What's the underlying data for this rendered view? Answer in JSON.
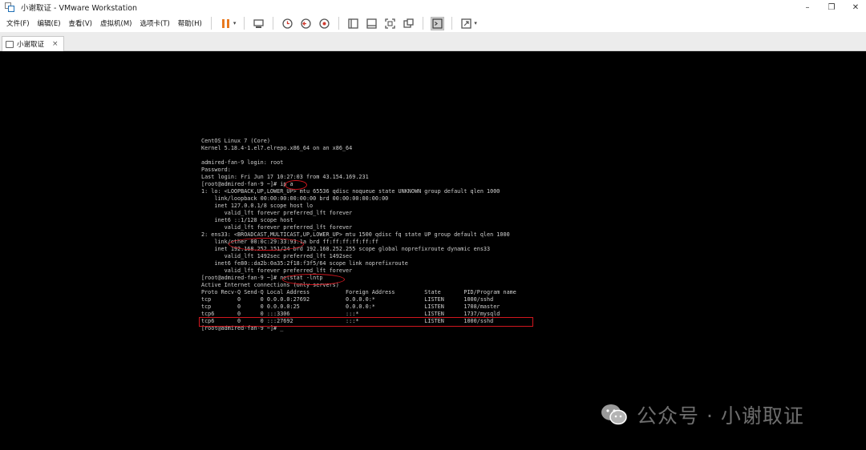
{
  "window": {
    "title": "小谢取证 - VMware Workstation",
    "controls": [
      "–",
      "❐",
      "✕"
    ]
  },
  "menu": {
    "items": [
      "文件(F)",
      "编辑(E)",
      "查看(V)",
      "虚拟机(M)",
      "选项卡(T)",
      "帮助(H)"
    ]
  },
  "toolbar": {
    "icons": [
      "pause-icon",
      "send-ctrl-alt-del-icon",
      "snapshot-icon",
      "revert-snapshot-icon",
      "snapshot-manager-icon",
      "view-normal-icon",
      "view-thumbnail-icon",
      "full-screen-icon",
      "unity-icon",
      "console-view-icon",
      "stretch-view-icon"
    ]
  },
  "tab": {
    "label": "小谢取证",
    "close": "×"
  },
  "terminal": {
    "lines": [
      "CentOS Linux 7 (Core)",
      "Kernel 5.18.4-1.el7.elrepo.x86_64 on an x86_64",
      "",
      "admired-fan-9 login: root",
      "Password:",
      "Last login: Fri Jun 17 10:27:03 from 43.154.169.231",
      "[root@admired-fan-9 ~]# ip a",
      "1: lo: <LOOPBACK,UP,LOWER_UP> mtu 65536 qdisc noqueue state UNKNOWN group default qlen 1000",
      "    link/loopback 00:00:00:00:00:00 brd 00:00:00:00:00:00",
      "    inet 127.0.0.1/8 scope host lo",
      "       valid_lft forever preferred_lft forever",
      "    inet6 ::1/128 scope host",
      "       valid_lft forever preferred_lft forever",
      "2: ens33: <BROADCAST,MULTICAST,UP,LOWER_UP> mtu 1500 qdisc fq state UP group default qlen 1000",
      "    link/ether 00:0c:29:33:93:1a brd ff:ff:ff:ff:ff:ff",
      "    inet 192.168.252.151/24 brd 192.168.252.255 scope global noprefixroute dynamic ens33",
      "       valid_lft 1492sec preferred_lft 1492sec",
      "    inet6 fe80::da2b:0a35:2f18:f3f5/64 scope link noprefixroute",
      "       valid_lft forever preferred_lft forever",
      "[root@admired-fan-9 ~]# netstat -lntp",
      "Active Internet connections (only servers)",
      "Proto Recv-Q Send-Q Local Address           Foreign Address         State       PID/Program name",
      "tcp        0      0 0.0.0.0:27692           0.0.0.0:*               LISTEN      1000/sshd",
      "tcp        0      0 0.0.0.0:25              0.0.0.0:*               LISTEN      1708/master",
      "tcp6       0      0 :::3306                 :::*                    LISTEN      1737/mysqld",
      "tcp6       0      0 :::27692                :::*                    LISTEN      1000/sshd",
      "[root@admired-fan-9 ~]# _"
    ]
  },
  "watermark": {
    "text": "公众号 · 小谢取证"
  },
  "colors": {
    "annotation": "#d0161e",
    "terminal_text": "#cfcfcf",
    "console_bg": "#000000"
  }
}
